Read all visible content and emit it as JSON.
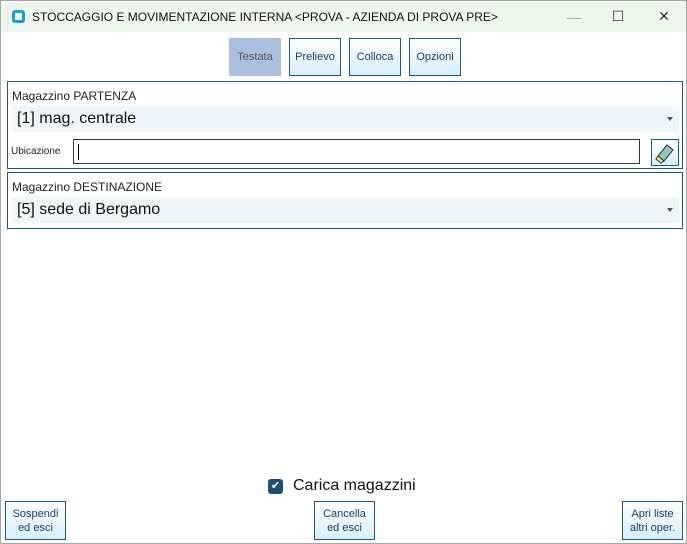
{
  "window": {
    "title": "STOCCAGGIO E MOVIMENTAZIONE INTERNA <PROVA - AZIENDA DI PROVA PRE>",
    "minimize": "—",
    "maximize": "☐",
    "close": "✕"
  },
  "tabs": [
    {
      "label": "Testata",
      "active": true
    },
    {
      "label": "Prelievo"
    },
    {
      "label": "Colloca"
    },
    {
      "label": "Opzioni"
    }
  ],
  "partenza": {
    "label": "Magazzino PARTENZA",
    "value": "[1] mag. centrale",
    "ubicazione_label": "Ubicazione",
    "ubicazione_value": ""
  },
  "destinazione": {
    "label": "Magazzino DESTINAZIONE",
    "value": "[5] sede di Bergamo"
  },
  "checkbox": {
    "label": "Carica magazzini",
    "checked": true,
    "mark": "✔"
  },
  "buttons": {
    "sospendi": [
      "Sospendi",
      "ed esci"
    ],
    "cancella": [
      "Cancella",
      "ed esci"
    ],
    "apri": [
      "Apri liste",
      "altri oper."
    ]
  }
}
